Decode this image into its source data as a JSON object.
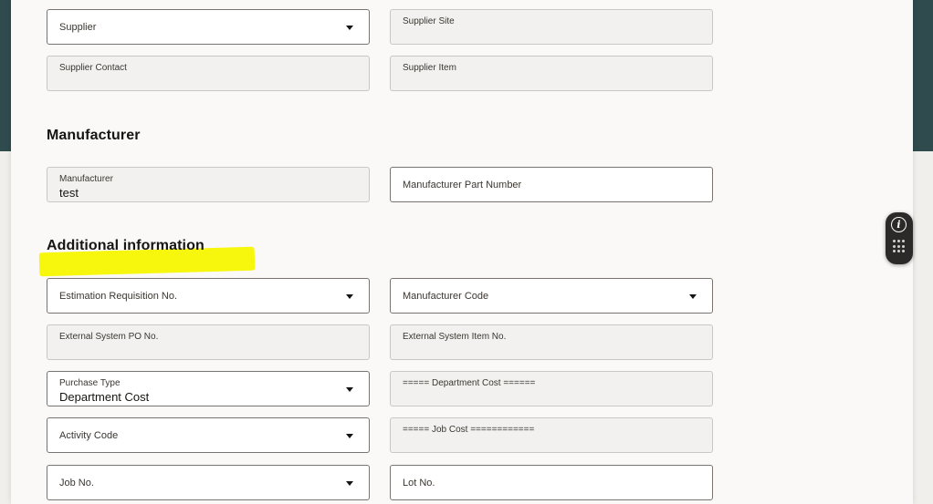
{
  "sections": {
    "manufacturer": "Manufacturer",
    "additional": "Additional information"
  },
  "fields": {
    "supplier": {
      "placeholder": "Supplier"
    },
    "supplier_site": {
      "label": "Supplier Site"
    },
    "supplier_contact": {
      "label": "Supplier Contact"
    },
    "supplier_item": {
      "label": "Supplier Item"
    },
    "manufacturer": {
      "label": "Manufacturer",
      "value": "test"
    },
    "manufacturer_part_number": {
      "placeholder": "Manufacturer Part Number"
    },
    "estimation_requisition_no": {
      "placeholder": "Estimation Requisition No."
    },
    "manufacturer_code": {
      "placeholder": "Manufacturer Code"
    },
    "external_system_po_no": {
      "label": "External System PO No."
    },
    "external_system_item_no": {
      "label": "External System Item No."
    },
    "purchase_type": {
      "label": "Purchase Type",
      "value": "Department Cost"
    },
    "department_cost_sep": {
      "label": "===== Department Cost ======"
    },
    "activity_code": {
      "placeholder": "Activity Code"
    },
    "job_cost_sep": {
      "label": "===== Job Cost ============"
    },
    "job_no": {
      "placeholder": "Job No."
    },
    "lot_no": {
      "placeholder": "Lot No."
    }
  },
  "icons": {
    "helper_info": "info-icon",
    "helper_grid": "grid-dots-icon"
  },
  "colors": {
    "header_band": "#2f4b4d",
    "highlight": "#f7f700",
    "field_border": "#79746f",
    "readonly_bg": "#f3f1ef"
  }
}
